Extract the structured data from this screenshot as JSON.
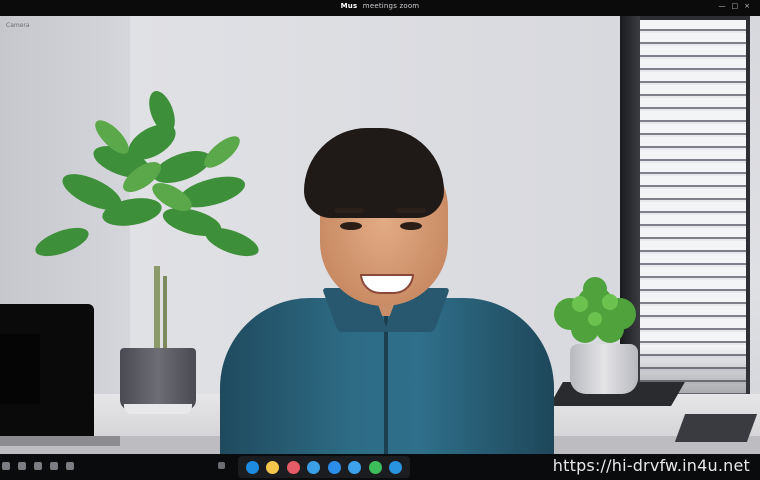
{
  "app": {
    "logo_text": "Mus",
    "window_title": "meetings zoom"
  },
  "top_controls": [
    {
      "label": "—"
    },
    {
      "label": "□"
    },
    {
      "label": "×"
    }
  ],
  "corner_label": "Camera",
  "watermark": "https://hi-drvfw.in4u.net",
  "icons": {
    "taskbar_left": [
      "mic-icon",
      "camera-icon",
      "share-icon",
      "grid-icon",
      "chat-icon"
    ],
    "taskbar_mid": [
      "record-icon",
      "reactions-icon",
      "more-icon"
    ],
    "dock": [
      "browser-icon",
      "files-icon",
      "calendar-icon",
      "mail-icon",
      "meetings-icon",
      "chat-app-icon",
      "phone-icon",
      "cloud-icon"
    ]
  },
  "colors": {
    "dock": [
      "#1c8be0",
      "#f3c64b",
      "#e55b66",
      "#3aa0e6",
      "#2b8de8",
      "#3da2ea",
      "#3cbf5b",
      "#2a93e0"
    ]
  }
}
